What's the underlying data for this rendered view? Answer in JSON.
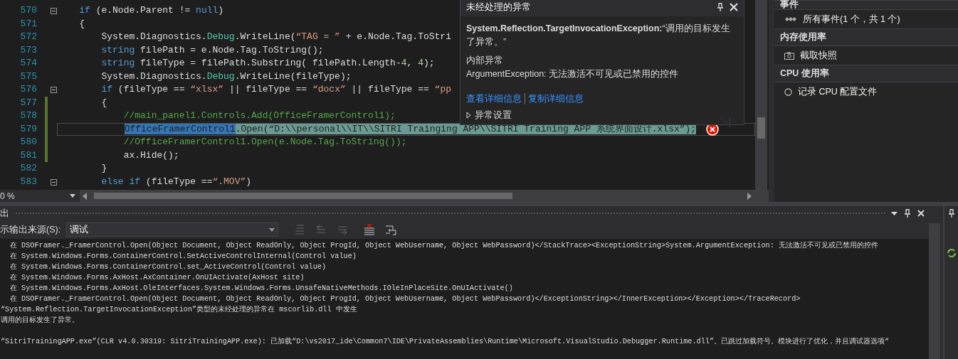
{
  "editor": {
    "lines": [
      {
        "number": "570",
        "collapsible": true,
        "changed": false,
        "current": false,
        "error": false,
        "segments": [
          {
            "kind": "keyword",
            "text": "    if"
          },
          {
            "kind": "plain",
            "text": " (e.Node.Parent != "
          },
          {
            "kind": "keyword",
            "text": "null"
          },
          {
            "kind": "plain",
            "text": ")"
          }
        ]
      },
      {
        "number": "571",
        "collapsible": false,
        "changed": false,
        "current": false,
        "error": false,
        "segments": [
          {
            "kind": "plain",
            "text": "    {"
          }
        ]
      },
      {
        "number": "572",
        "collapsible": false,
        "changed": false,
        "current": false,
        "error": false,
        "segments": [
          {
            "kind": "plain",
            "text": "        System.Diagnostics."
          },
          {
            "kind": "type",
            "text": "Debug"
          },
          {
            "kind": "plain",
            "text": ".WriteLine("
          },
          {
            "kind": "string",
            "text": "“TAG = ”"
          },
          {
            "kind": "plain",
            "text": " + e.Node.Tag.ToStri"
          }
        ]
      },
      {
        "number": "573",
        "collapsible": false,
        "changed": false,
        "current": false,
        "error": false,
        "segments": [
          {
            "kind": "keyword",
            "text": "        string"
          },
          {
            "kind": "plain",
            "text": " filePath = e.Node.Tag.ToString();"
          }
        ]
      },
      {
        "number": "574",
        "collapsible": false,
        "changed": false,
        "current": false,
        "error": false,
        "segments": [
          {
            "kind": "keyword",
            "text": "        string"
          },
          {
            "kind": "plain",
            "text": " fileType = filePath.Substring( filePath.Length-"
          },
          {
            "kind": "number",
            "text": "4"
          },
          {
            "kind": "plain",
            "text": ", "
          },
          {
            "kind": "number",
            "text": "4"
          },
          {
            "kind": "plain",
            "text": ");"
          }
        ]
      },
      {
        "number": "575",
        "collapsible": false,
        "changed": false,
        "current": false,
        "error": false,
        "segments": [
          {
            "kind": "plain",
            "text": "        System.Diagnostics."
          },
          {
            "kind": "type",
            "text": "Debug"
          },
          {
            "kind": "plain",
            "text": ".WriteLine(fileType);"
          }
        ]
      },
      {
        "number": "576",
        "collapsible": true,
        "changed": false,
        "current": false,
        "error": false,
        "segments": [
          {
            "kind": "keyword",
            "text": "        if"
          },
          {
            "kind": "plain",
            "text": " (fileType == "
          },
          {
            "kind": "string",
            "text": "“xlsx”"
          },
          {
            "kind": "plain",
            "text": " || fileType == "
          },
          {
            "kind": "string",
            "text": "“docx”"
          },
          {
            "kind": "plain",
            "text": " || fileType == "
          },
          {
            "kind": "string",
            "text": "“pp"
          }
        ]
      },
      {
        "number": "577",
        "collapsible": false,
        "changed": true,
        "current": false,
        "error": false,
        "segments": [
          {
            "kind": "plain",
            "text": "        {"
          }
        ]
      },
      {
        "number": "578",
        "collapsible": false,
        "changed": true,
        "current": false,
        "error": false,
        "segments": [
          {
            "kind": "comment",
            "text": "            //main_panel1.Controls.Add(OfficeFramerControl1);"
          }
        ]
      },
      {
        "number": "579",
        "collapsible": false,
        "changed": true,
        "current": true,
        "error": true,
        "segments": [
          {
            "kind": "selection",
            "text": "            OfficeFramerControl1"
          },
          {
            "kind": "plain",
            "text": ".Open(“D:\\\\personal\\\\IT\\\\SITRI Trainging APP\\\\SITRI Training APP 系统界面设计.xlsx”);"
          }
        ]
      },
      {
        "number": "580",
        "collapsible": false,
        "changed": true,
        "current": false,
        "error": false,
        "segments": [
          {
            "kind": "comment",
            "text": "            //OfficeFramerControl1.Open(e.Node.Tag.ToString());"
          }
        ]
      },
      {
        "number": "581",
        "collapsible": false,
        "changed": true,
        "current": false,
        "error": false,
        "segments": [
          {
            "kind": "plain",
            "text": "            ax.Hide();"
          }
        ]
      },
      {
        "number": "582",
        "collapsible": false,
        "changed": false,
        "current": false,
        "error": false,
        "segments": [
          {
            "kind": "plain",
            "text": "        }"
          }
        ]
      },
      {
        "number": "583",
        "collapsible": true,
        "changed": false,
        "current": false,
        "error": false,
        "segments": [
          {
            "kind": "keyword",
            "text": "        else if"
          },
          {
            "kind": "plain",
            "text": " (fileType =="
          },
          {
            "kind": "string",
            "text": "“.MOV”"
          },
          {
            "kind": "plain",
            "text": ")"
          }
        ]
      }
    ],
    "zoom": "0 %"
  },
  "exception_popup": {
    "title": "未经处理的异常",
    "message": "**System.Reflection.TargetInvocationException:**“调用的目标发生了异常。”",
    "inner_title": "内部异常",
    "inner_message": "ArgumentException: 无法激活不可见或已禁用的控件",
    "links": [
      "查看详细信息",
      "复制详细信息"
    ],
    "settings": {
      "label": "异常设置",
      "expanded": false
    }
  },
  "diagnostics_panel": {
    "sections": [
      {
        "title": "事件",
        "items": [
          {
            "kind": "events",
            "label": "所有事件(1 个，共 1 个)"
          }
        ]
      },
      {
        "title": "内存使用率",
        "items": [
          {
            "kind": "snapshot",
            "label": "截取快照"
          }
        ]
      },
      {
        "title": "CPU 使用率",
        "items": [
          {
            "kind": "record",
            "label": "记录 CPU 配置文件"
          }
        ]
      }
    ]
  },
  "output_panel": {
    "title": "出",
    "source_label": "示输出来源(S):",
    "source": "调试",
    "lines": [
      {
        "kind": "trace",
        "text": "在 DSOFramer._FramerControl.Open(Object Document, Object ReadOnly, Object ProgId, Object WebUsername, Object WebPassword)</StackTrace><ExceptionString>System.ArgumentException: 无法激活不可见或已禁用的控件"
      },
      {
        "kind": "trace",
        "text": "在 System.Windows.Forms.ContainerControl.SetActiveControlInternal(Control value)"
      },
      {
        "kind": "trace",
        "text": "在 System.Windows.Forms.ContainerControl.set_ActiveControl(Control value)"
      },
      {
        "kind": "trace",
        "text": "在 System.Windows.Forms.AxHost.AxContainer.OnUIActivate(AxHost site)"
      },
      {
        "kind": "trace",
        "text": "在 System.Windows.Forms.AxHost.OleInterfaces.System.Windows.Forms.UnsafeNativeMethods.IOleInPlaceSite.OnUIActivate()"
      },
      {
        "kind": "trace",
        "text": "在 DSOFramer._FramerControl.Open(Object Document, Object ReadOnly, Object ProgId, Object WebUsername, Object WebPassword)</ExceptionString></InnerException></Exception></TraceRecord>"
      },
      {
        "kind": "message",
        "text": "“System.Reflection.TargetInvocationException”类型的未经处理的异常在 mscorlib.dll 中发生"
      },
      {
        "kind": "message",
        "text": "调用的目标发生了异常。"
      },
      {
        "kind": "blank"
      },
      {
        "kind": "message",
        "text": "“SitriTrainingAPP.exe”(CLR v4.0.30319: SitriTrainingAPP.exe): 已加载“D:\\vs2017_ide\\Common7\\IDE\\PrivateAssemblies\\Runtime\\Microsoft.VisualStudio.Debugger.Runtime.dll”。已跳过加载符号。模块进行了优化，并且调试器选项“"
      }
    ]
  }
}
